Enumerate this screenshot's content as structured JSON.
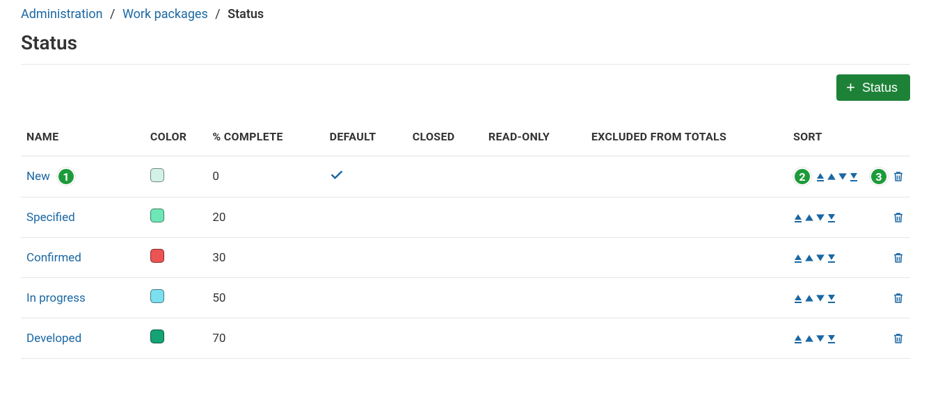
{
  "breadcrumb": {
    "items": [
      {
        "label": "Administration",
        "link": true
      },
      {
        "label": "Work packages",
        "link": true
      },
      {
        "label": "Status",
        "link": false
      }
    ]
  },
  "page_title": "Status",
  "toolbar": {
    "add_status_label": "Status"
  },
  "markers": {
    "m1": "1",
    "m2": "2",
    "m3": "3"
  },
  "table": {
    "headers": {
      "name": "NAME",
      "color": "COLOR",
      "pct": "% COMPLETE",
      "default": "DEFAULT",
      "closed": "CLOSED",
      "readonly": "READ-ONLY",
      "excluded": "EXCLUDED FROM TOTALS",
      "sort": "SORT"
    },
    "rows": [
      {
        "name": "New",
        "color": "#d3f2e7",
        "pct": "0",
        "default": true,
        "marker1": true,
        "marker2": true,
        "marker3": true
      },
      {
        "name": "Specified",
        "color": "#6ee7b7",
        "pct": "20",
        "default": false,
        "marker1": false,
        "marker2": false,
        "marker3": false
      },
      {
        "name": "Confirmed",
        "color": "#ec5353",
        "pct": "30",
        "default": false,
        "marker1": false,
        "marker2": false,
        "marker3": false
      },
      {
        "name": "In progress",
        "color": "#7adfef",
        "pct": "50",
        "default": false,
        "marker1": false,
        "marker2": false,
        "marker3": false
      },
      {
        "name": "Developed",
        "color": "#15a375",
        "pct": "70",
        "default": false,
        "marker1": false,
        "marker2": false,
        "marker3": false
      }
    ]
  }
}
